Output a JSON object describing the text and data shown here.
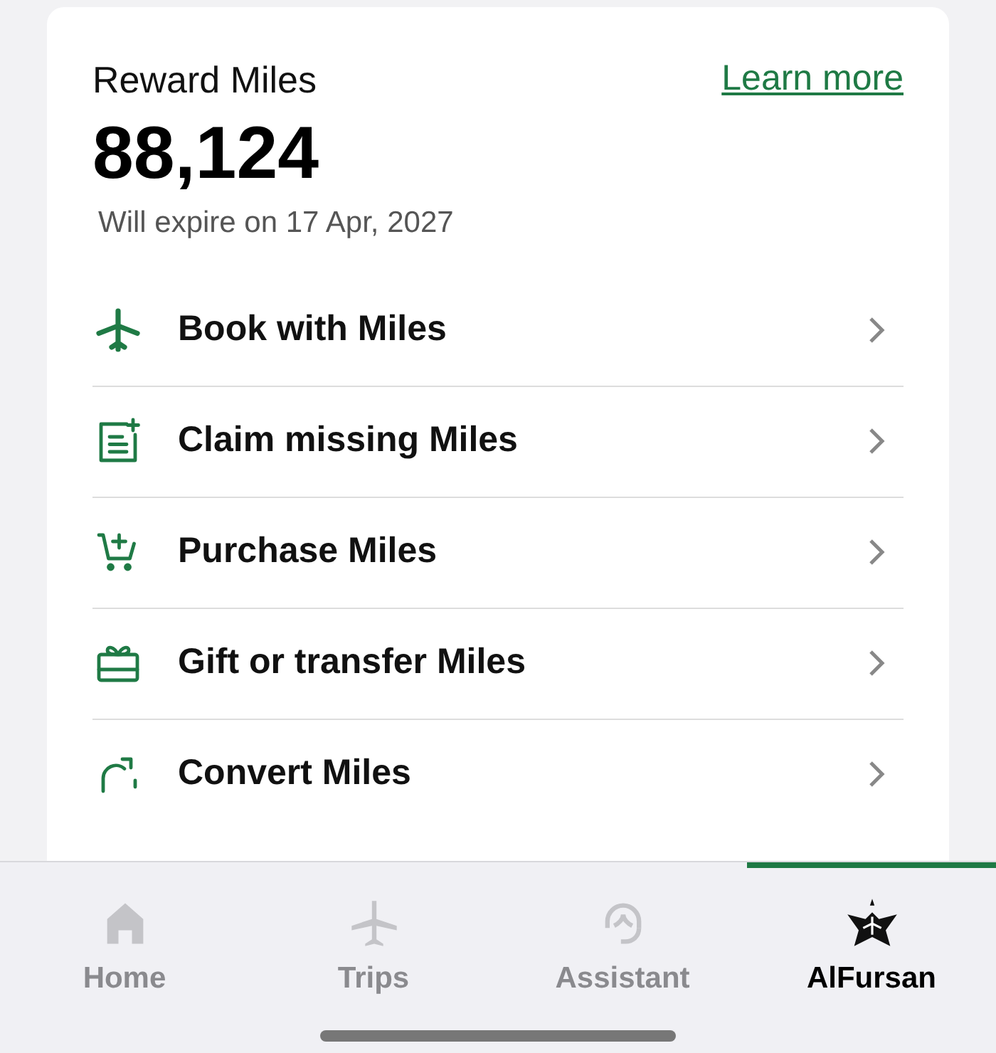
{
  "rewards": {
    "title": "Reward Miles",
    "link": "Learn more",
    "balance": "88,124",
    "expiry": "Will expire on 17 Apr, 2027"
  },
  "actions": [
    {
      "kind": "plane",
      "label": "Book with Miles"
    },
    {
      "kind": "claim",
      "label": "Claim missing Miles"
    },
    {
      "kind": "cart",
      "label": "Purchase Miles"
    },
    {
      "kind": "gift",
      "label": "Gift or transfer Miles"
    },
    {
      "kind": "convert",
      "label": "Convert Miles"
    }
  ],
  "tab_bar": [
    {
      "kind": "home",
      "label": "Home",
      "selected": false
    },
    {
      "kind": "trips",
      "label": "Trips",
      "selected": false
    },
    {
      "kind": "assistant",
      "label": "Assistant",
      "selected": false
    },
    {
      "kind": "alfursan",
      "label": "AlFursan",
      "selected": true
    }
  ]
}
